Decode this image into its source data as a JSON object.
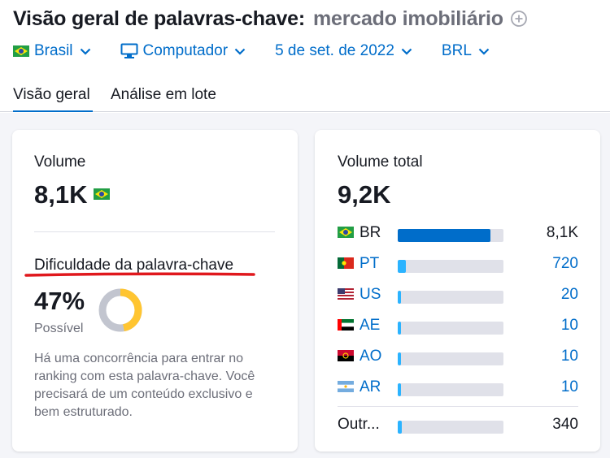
{
  "header": {
    "title": "Visão geral de palavras-chave:",
    "keyword": "mercado imobiliário"
  },
  "filters": {
    "country": "Brasil",
    "device": "Computador",
    "date": "5 de set. de 2022",
    "currency": "BRL"
  },
  "tabs": [
    {
      "label": "Visão geral"
    },
    {
      "label": "Análise em lote"
    }
  ],
  "volume_card": {
    "volume_label": "Volume",
    "volume_value": "8,1K",
    "difficulty_label": "Dificuldade da palavra-chave",
    "difficulty_percent": "47%",
    "difficulty_level": "Possível",
    "difficulty_fraction": 0.47,
    "description": "Há uma concorrência para entrar no ranking com esta palavra-chave. Você precisará de um conteúdo exclusivo e bem estruturado."
  },
  "total_card": {
    "label": "Volume total",
    "value": "9,2K",
    "countries": [
      {
        "code": "BR",
        "value": "8,1K",
        "fraction": 0.88
      },
      {
        "code": "PT",
        "value": "720",
        "fraction": 0.08
      },
      {
        "code": "US",
        "value": "20",
        "fraction": 0.03
      },
      {
        "code": "AE",
        "value": "10",
        "fraction": 0.03
      },
      {
        "code": "AO",
        "value": "10",
        "fraction": 0.03
      },
      {
        "code": "AR",
        "value": "10",
        "fraction": 0.03
      }
    ],
    "other": {
      "label": "Outr...",
      "value": "340",
      "fraction": 0.04
    }
  },
  "colors": {
    "accent": "#006dca",
    "bar_primary": "#006dca",
    "bar_light": "#2bb3ff",
    "track": "#e0e1e9",
    "donut": "#ffc531",
    "donut_track": "#c2c5cf",
    "highlight": "#e0181d"
  },
  "icons": {
    "add": "plus-circle-icon",
    "chevron": "chevron-down-icon",
    "device": "desktop-icon"
  }
}
